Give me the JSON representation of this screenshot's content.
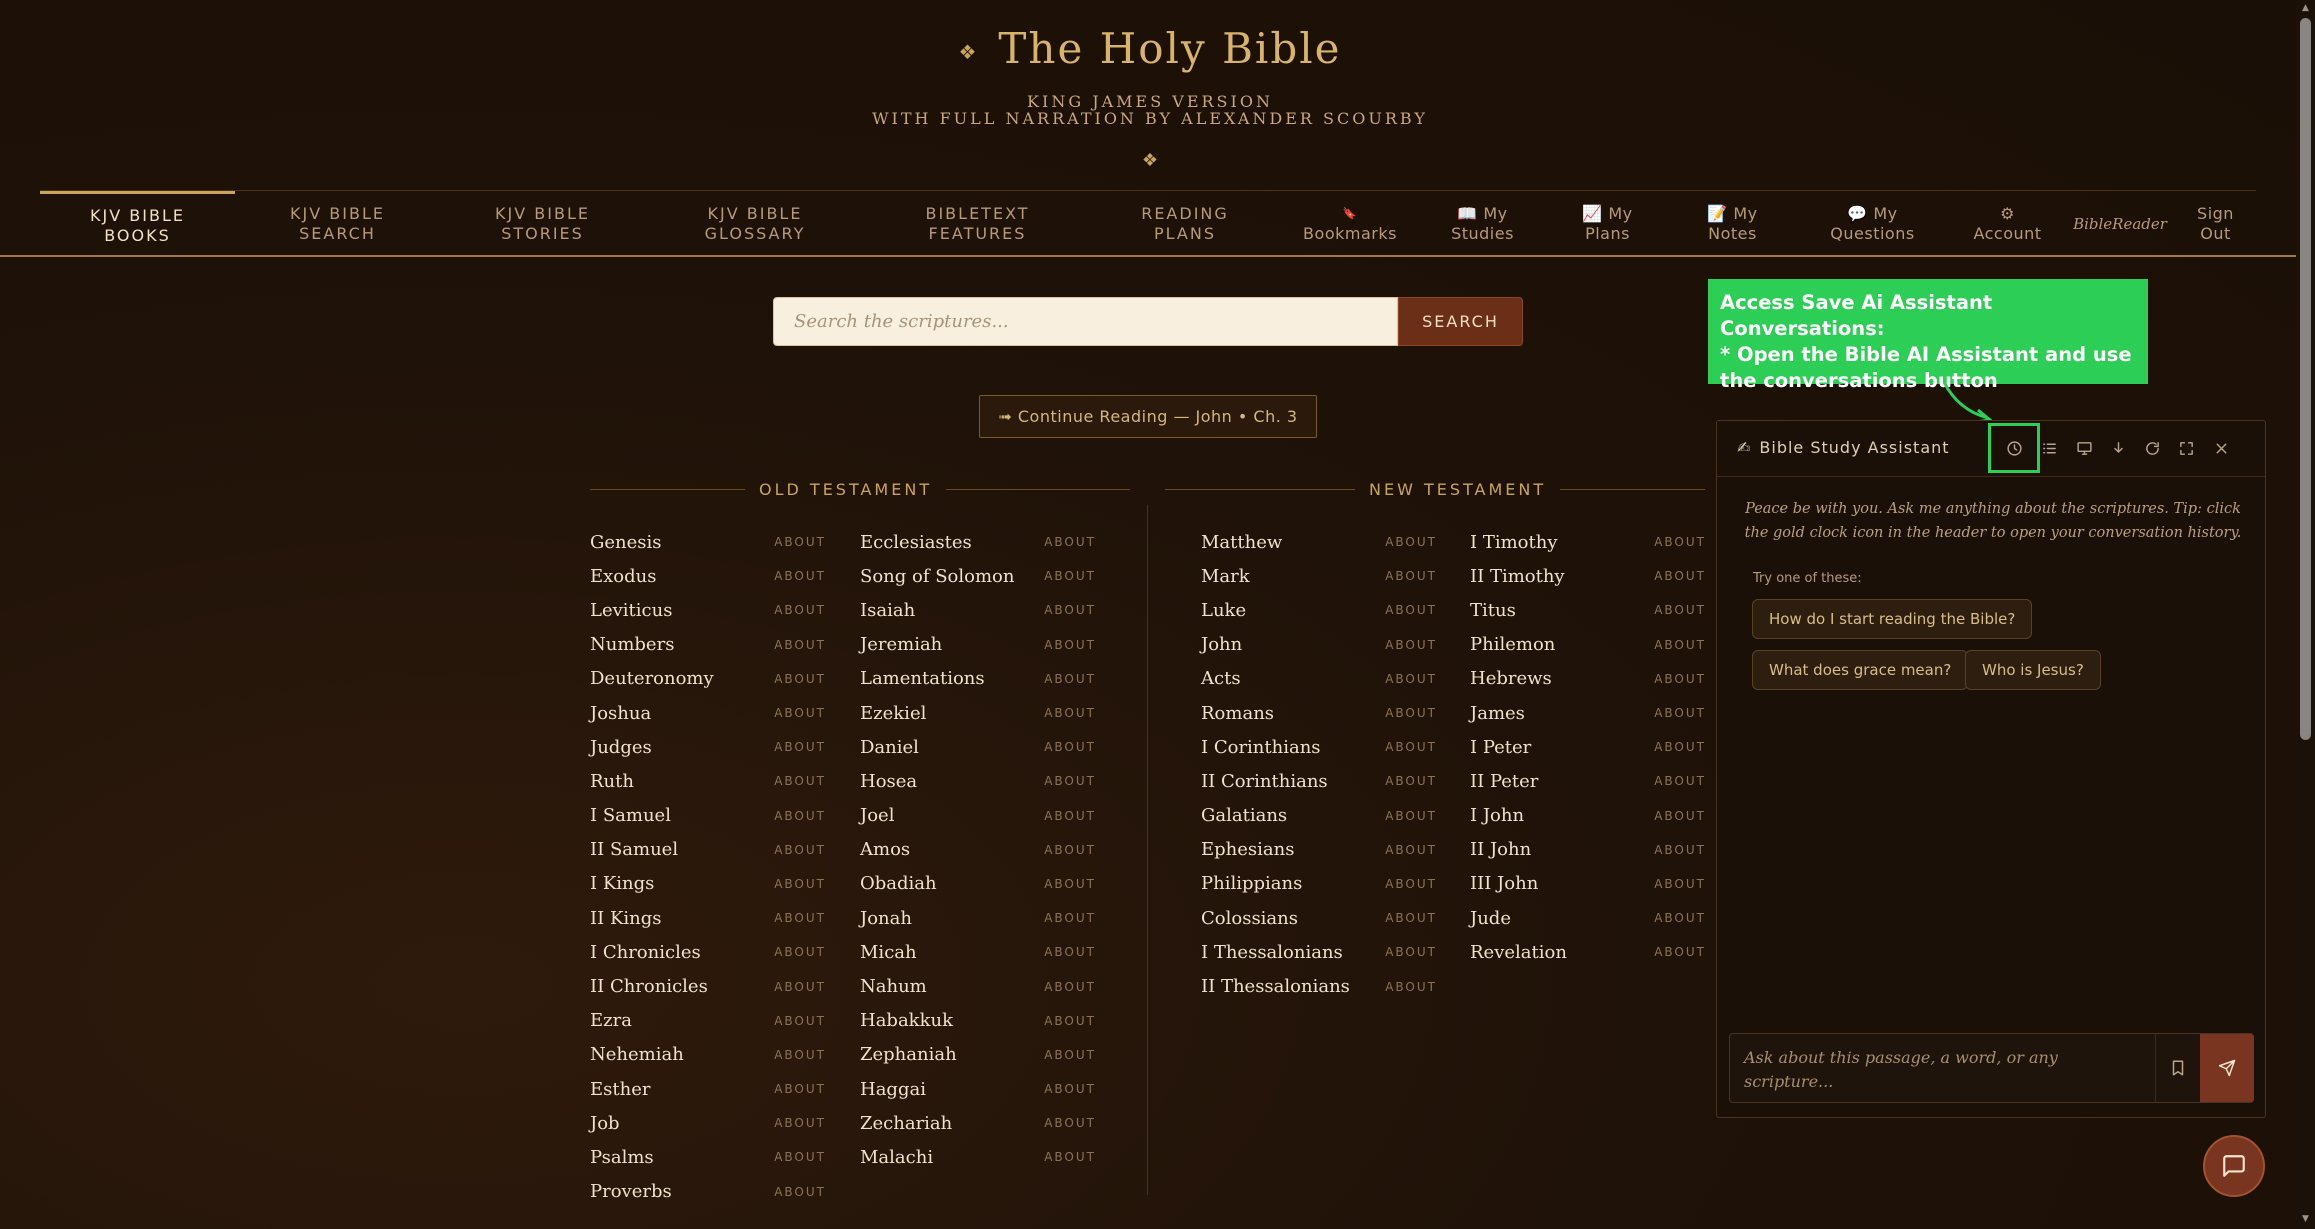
{
  "header": {
    "ornament": "❖",
    "title": "The Holy Bible",
    "subtitle_line1": "KING JAMES VERSION",
    "subtitle_line2": "WITH FULL NARRATION BY ALEXANDER SCOURBY",
    "ornament2": "❖"
  },
  "nav": [
    {
      "line1": "KJV BIBLE",
      "line2": "BOOKS"
    },
    {
      "line1": "KJV BIBLE",
      "line2": "SEARCH"
    },
    {
      "line1": "KJV BIBLE",
      "line2": "STORIES"
    },
    {
      "line1": "KJV BIBLE",
      "line2": "GLOSSARY"
    },
    {
      "line1": "BIBLETEXT",
      "line2": "FEATURES"
    },
    {
      "line1": "READING",
      "line2": "PLANS"
    },
    {
      "line1": "🔖",
      "line2": "Bookmarks"
    },
    {
      "line1": "📖 My",
      "line2": "Studies"
    },
    {
      "line1": "📈 My",
      "line2": "Plans"
    },
    {
      "line1": "📝 My",
      "line2": "Notes"
    },
    {
      "line1": "💬 My",
      "line2": "Questions"
    },
    {
      "line1": "⚙",
      "line2": "Account"
    },
    {
      "line1": "BibleReader",
      "line2": ""
    },
    {
      "line1": "Sign",
      "line2": "Out"
    }
  ],
  "search": {
    "placeholder": "Search the scriptures...",
    "button": "SEARCH"
  },
  "continue_reading": "➟ Continue Reading — John • Ch. 3",
  "old_testament": {
    "heading": "OLD TESTAMENT",
    "about_label": "ABOUT",
    "col1": [
      "Genesis",
      "Exodus",
      "Leviticus",
      "Numbers",
      "Deuteronomy",
      "Joshua",
      "Judges",
      "Ruth",
      "I Samuel",
      "II Samuel",
      "I Kings",
      "II Kings",
      "I Chronicles",
      "II Chronicles",
      "Ezra",
      "Nehemiah",
      "Esther",
      "Job",
      "Psalms",
      "Proverbs"
    ],
    "col2": [
      "Ecclesiastes",
      "Song of Solomon",
      "Isaiah",
      "Jeremiah",
      "Lamentations",
      "Ezekiel",
      "Daniel",
      "Hosea",
      "Joel",
      "Amos",
      "Obadiah",
      "Jonah",
      "Micah",
      "Nahum",
      "Habakkuk",
      "Zephaniah",
      "Haggai",
      "Zechariah",
      "Malachi"
    ]
  },
  "new_testament": {
    "heading": "NEW TESTAMENT",
    "about_label": "ABOUT",
    "col1": [
      "Matthew",
      "Mark",
      "Luke",
      "John",
      "Acts",
      "Romans",
      "I Corinthians",
      "II Corinthians",
      "Galatians",
      "Ephesians",
      "Philippians",
      "Colossians",
      "I Thessalonians",
      "II Thessalonians"
    ],
    "col2": [
      "I Timothy",
      "II Timothy",
      "Titus",
      "Philemon",
      "Hebrews",
      "James",
      "I Peter",
      "II Peter",
      "I John",
      "II John",
      "III John",
      "Jude",
      "Revelation"
    ]
  },
  "chat": {
    "emoji": "✍",
    "title": "Bible Study Assistant",
    "intro": "Peace be with you. Ask me anything about the scriptures. Tip: click the gold clock icon in the header to open your conversation history.",
    "try_label": "Try one of these:",
    "chips": [
      "How do I start reading the Bible?",
      "What does grace mean?",
      "Who is Jesus?"
    ],
    "input_placeholder": "Ask about this passage, a word, or any scripture...",
    "header_icons": [
      "clock-icon",
      "list-icon",
      "monitor-icon",
      "download-icon",
      "refresh-icon",
      "expand-icon",
      "close-icon"
    ]
  },
  "callout": {
    "text_line1": "Access Save Ai Assistant Conversations:",
    "text_line2": "* Open the Bible AI Assistant and use",
    "text_line3": "the conversations button",
    "color": "#2dce56"
  },
  "colors": {
    "accent_gold": "#c9a55b",
    "background": "#1f1208",
    "button_brown": "#7a3520"
  }
}
